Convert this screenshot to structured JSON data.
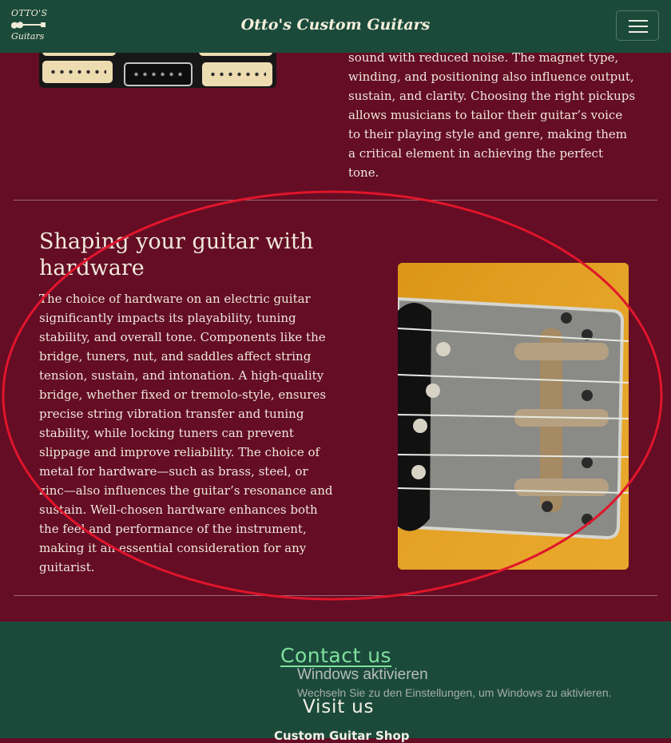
{
  "navbar": {
    "logo_top": "OTTO'S",
    "logo_bottom": "Guitars",
    "brand": "Otto's Custom Guitars",
    "menu_icon": "hamburger-menu-icon"
  },
  "pickups_section": {
    "image_icon": "guitar-pickups-image",
    "text_tail": "sound with reduced noise. The magnet type, winding, and positioning also influence output, sustain, and clarity. Choosing the right pickups allows musicians to tailor their guitar’s voice to their playing style and genre, making them a critical element in achieving the perfect tone."
  },
  "hardware_section": {
    "title": "Shaping your guitar with hardware",
    "body": "The choice of hardware on an electric guitar significantly impacts its playability, tuning stability, and overall tone. Components like the bridge, tuners, nut, and saddles affect string tension, sustain, and intonation. A high-quality bridge, whether fixed or tremolo-style, ensures precise string vibration transfer and tuning stability, while locking tuners can prevent slippage and improve reliability. The choice of metal for hardware—such as brass, steel, or zinc—also influences the guitar’s resonance and sustain. Well-chosen hardware enhances both the feel and performance of the instrument, making it an essential consideration for any guitarist.",
    "image_icon": "guitar-bridge-image"
  },
  "footer": {
    "contact": "Contact us",
    "visit": "Visit us",
    "shop": "Custom Guitar Shop"
  },
  "windows_overlay": {
    "title": "Windows aktivieren",
    "subtitle": "Wechseln Sie zu den Einstellungen, um Windows zu aktivieren."
  },
  "colors": {
    "navbar": "#1b4a3b",
    "page": "#640d24",
    "contact_link": "#7fe09d",
    "annotation": "#e0152c"
  }
}
